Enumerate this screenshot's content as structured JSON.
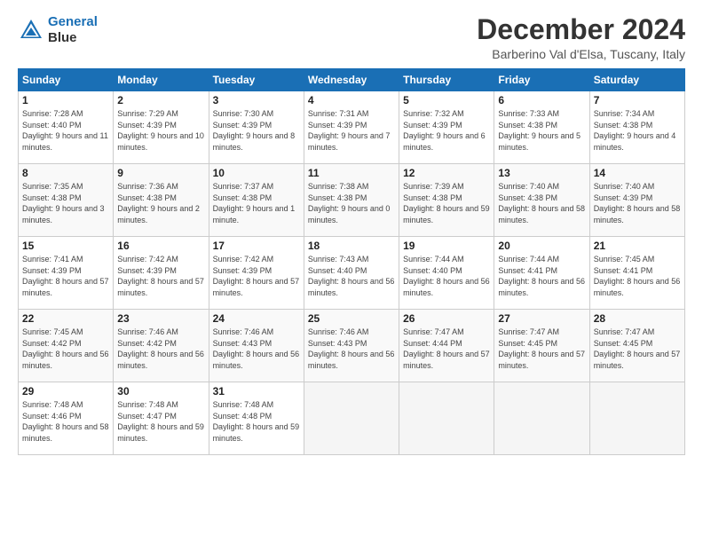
{
  "logo": {
    "line1": "General",
    "line2": "Blue"
  },
  "title": "December 2024",
  "subtitle": "Barberino Val d'Elsa, Tuscany, Italy",
  "days_of_week": [
    "Sunday",
    "Monday",
    "Tuesday",
    "Wednesday",
    "Thursday",
    "Friday",
    "Saturday"
  ],
  "weeks": [
    [
      {
        "day": 1,
        "sunrise": "7:28 AM",
        "sunset": "4:40 PM",
        "daylight": "9 hours and 11 minutes."
      },
      {
        "day": 2,
        "sunrise": "7:29 AM",
        "sunset": "4:39 PM",
        "daylight": "9 hours and 10 minutes."
      },
      {
        "day": 3,
        "sunrise": "7:30 AM",
        "sunset": "4:39 PM",
        "daylight": "9 hours and 8 minutes."
      },
      {
        "day": 4,
        "sunrise": "7:31 AM",
        "sunset": "4:39 PM",
        "daylight": "9 hours and 7 minutes."
      },
      {
        "day": 5,
        "sunrise": "7:32 AM",
        "sunset": "4:39 PM",
        "daylight": "9 hours and 6 minutes."
      },
      {
        "day": 6,
        "sunrise": "7:33 AM",
        "sunset": "4:38 PM",
        "daylight": "9 hours and 5 minutes."
      },
      {
        "day": 7,
        "sunrise": "7:34 AM",
        "sunset": "4:38 PM",
        "daylight": "9 hours and 4 minutes."
      }
    ],
    [
      {
        "day": 8,
        "sunrise": "7:35 AM",
        "sunset": "4:38 PM",
        "daylight": "9 hours and 3 minutes."
      },
      {
        "day": 9,
        "sunrise": "7:36 AM",
        "sunset": "4:38 PM",
        "daylight": "9 hours and 2 minutes."
      },
      {
        "day": 10,
        "sunrise": "7:37 AM",
        "sunset": "4:38 PM",
        "daylight": "9 hours and 1 minute."
      },
      {
        "day": 11,
        "sunrise": "7:38 AM",
        "sunset": "4:38 PM",
        "daylight": "9 hours and 0 minutes."
      },
      {
        "day": 12,
        "sunrise": "7:39 AM",
        "sunset": "4:38 PM",
        "daylight": "8 hours and 59 minutes."
      },
      {
        "day": 13,
        "sunrise": "7:40 AM",
        "sunset": "4:38 PM",
        "daylight": "8 hours and 58 minutes."
      },
      {
        "day": 14,
        "sunrise": "7:40 AM",
        "sunset": "4:39 PM",
        "daylight": "8 hours and 58 minutes."
      }
    ],
    [
      {
        "day": 15,
        "sunrise": "7:41 AM",
        "sunset": "4:39 PM",
        "daylight": "8 hours and 57 minutes."
      },
      {
        "day": 16,
        "sunrise": "7:42 AM",
        "sunset": "4:39 PM",
        "daylight": "8 hours and 57 minutes."
      },
      {
        "day": 17,
        "sunrise": "7:42 AM",
        "sunset": "4:39 PM",
        "daylight": "8 hours and 57 minutes."
      },
      {
        "day": 18,
        "sunrise": "7:43 AM",
        "sunset": "4:40 PM",
        "daylight": "8 hours and 56 minutes."
      },
      {
        "day": 19,
        "sunrise": "7:44 AM",
        "sunset": "4:40 PM",
        "daylight": "8 hours and 56 minutes."
      },
      {
        "day": 20,
        "sunrise": "7:44 AM",
        "sunset": "4:41 PM",
        "daylight": "8 hours and 56 minutes."
      },
      {
        "day": 21,
        "sunrise": "7:45 AM",
        "sunset": "4:41 PM",
        "daylight": "8 hours and 56 minutes."
      }
    ],
    [
      {
        "day": 22,
        "sunrise": "7:45 AM",
        "sunset": "4:42 PM",
        "daylight": "8 hours and 56 minutes."
      },
      {
        "day": 23,
        "sunrise": "7:46 AM",
        "sunset": "4:42 PM",
        "daylight": "8 hours and 56 minutes."
      },
      {
        "day": 24,
        "sunrise": "7:46 AM",
        "sunset": "4:43 PM",
        "daylight": "8 hours and 56 minutes."
      },
      {
        "day": 25,
        "sunrise": "7:46 AM",
        "sunset": "4:43 PM",
        "daylight": "8 hours and 56 minutes."
      },
      {
        "day": 26,
        "sunrise": "7:47 AM",
        "sunset": "4:44 PM",
        "daylight": "8 hours and 57 minutes."
      },
      {
        "day": 27,
        "sunrise": "7:47 AM",
        "sunset": "4:45 PM",
        "daylight": "8 hours and 57 minutes."
      },
      {
        "day": 28,
        "sunrise": "7:47 AM",
        "sunset": "4:45 PM",
        "daylight": "8 hours and 57 minutes."
      }
    ],
    [
      {
        "day": 29,
        "sunrise": "7:48 AM",
        "sunset": "4:46 PM",
        "daylight": "8 hours and 58 minutes."
      },
      {
        "day": 30,
        "sunrise": "7:48 AM",
        "sunset": "4:47 PM",
        "daylight": "8 hours and 59 minutes."
      },
      {
        "day": 31,
        "sunrise": "7:48 AM",
        "sunset": "4:48 PM",
        "daylight": "8 hours and 59 minutes."
      },
      null,
      null,
      null,
      null
    ]
  ]
}
